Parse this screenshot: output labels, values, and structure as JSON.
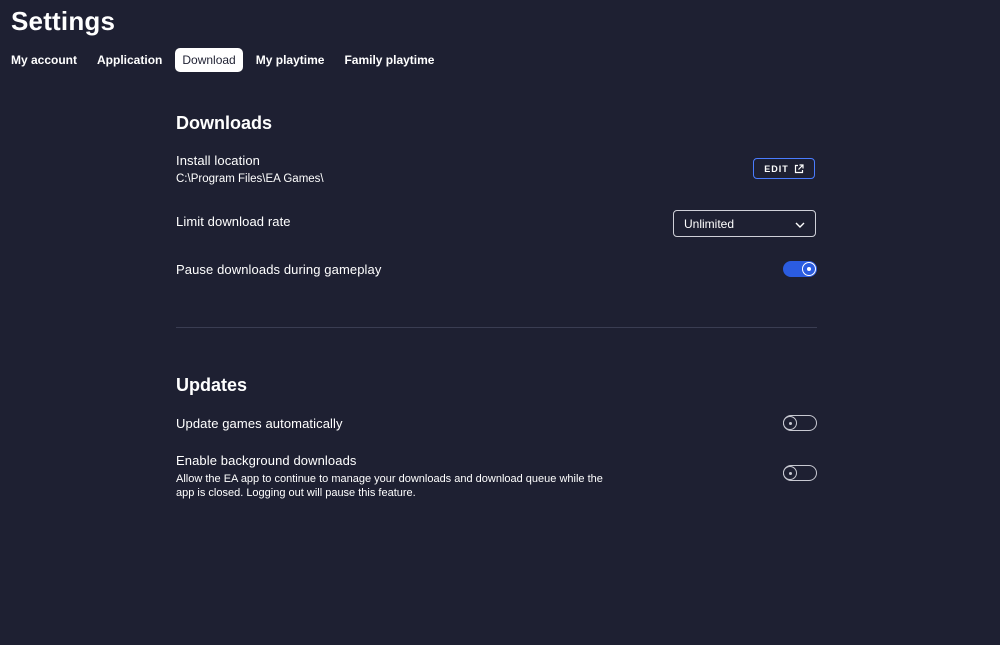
{
  "page": {
    "title": "Settings"
  },
  "tabs": [
    {
      "label": "My account",
      "active": false
    },
    {
      "label": "Application",
      "active": false
    },
    {
      "label": "Download",
      "active": true
    },
    {
      "label": "My playtime",
      "active": false
    },
    {
      "label": "Family playtime",
      "active": false
    }
  ],
  "downloads": {
    "title": "Downloads",
    "install_location": {
      "label": "Install location",
      "value": "C:\\Program Files\\EA Games\\",
      "edit_label": "EDIT",
      "edit_icon": "external-link-icon"
    },
    "limit_rate": {
      "label": "Limit download rate",
      "selected": "Unlimited",
      "icon": "chevron-down-icon"
    },
    "pause_during_gameplay": {
      "label": "Pause downloads during gameplay",
      "enabled": true
    }
  },
  "updates": {
    "title": "Updates",
    "auto_update": {
      "label": "Update games automatically",
      "enabled": false
    },
    "background_downloads": {
      "label": "Enable background downloads",
      "description_line1": "Allow the EA app to continue to manage your downloads and download queue while the",
      "description_line2": "app is closed. Logging out will pause this feature.",
      "enabled": false
    }
  },
  "colors": {
    "background": "#1e2032",
    "accent": "#2b5ce0",
    "edit_border": "#4a7cff",
    "divider": "#3a3d52"
  }
}
